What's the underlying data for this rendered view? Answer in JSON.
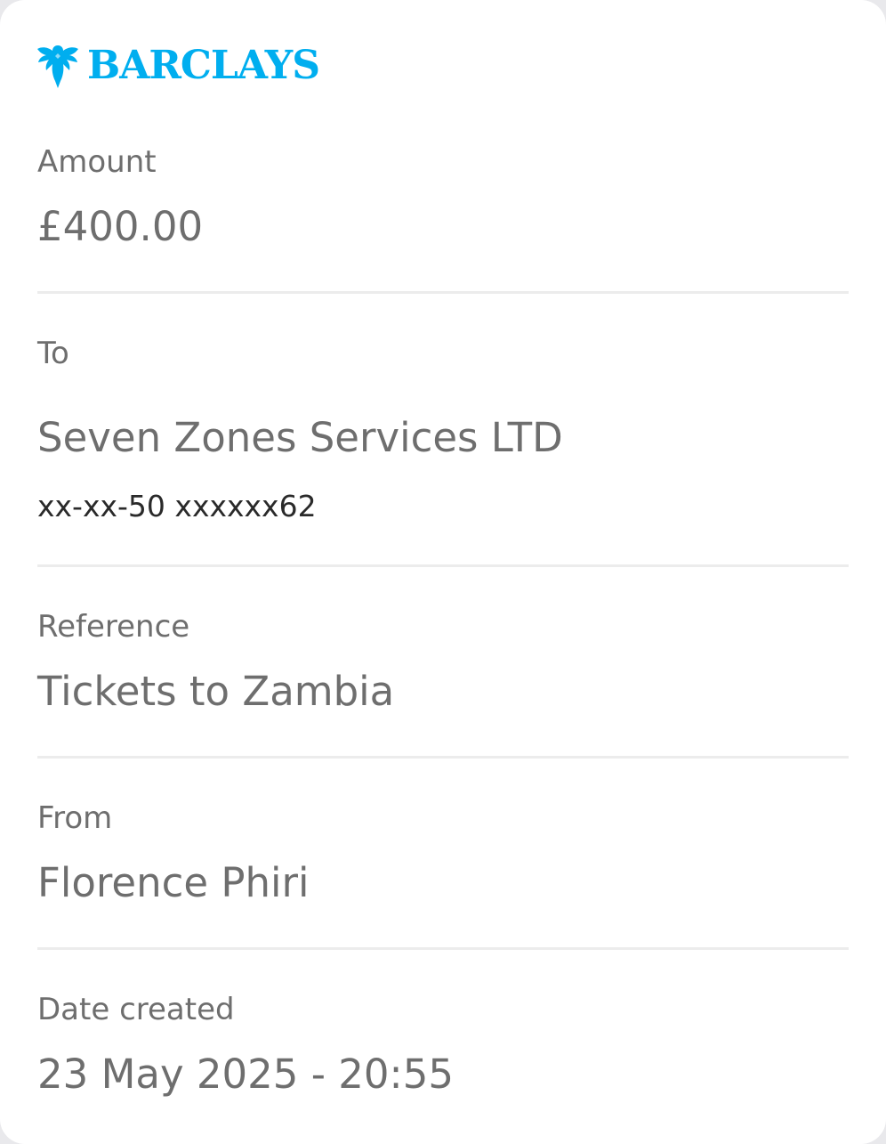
{
  "brand": {
    "name": "BARCLAYS",
    "logo_icon": "eagle-icon",
    "color": "#00aeef"
  },
  "fields": {
    "amount": {
      "label": "Amount",
      "value": "£400.00"
    },
    "to": {
      "label": "To",
      "value": "Seven Zones Services LTD",
      "account": "xx-xx-50 xxxxxx62"
    },
    "reference": {
      "label": "Reference",
      "value": "Tickets to Zambia"
    },
    "from": {
      "label": "From",
      "value": "Florence Phiri"
    },
    "date_created": {
      "label": "Date created",
      "value": "23 May 2025 - 20:55"
    }
  },
  "colors": {
    "text_muted": "#6e6e6e",
    "text_dark": "#2a2a2a",
    "divider": "#ececec",
    "background": "#ffffff"
  }
}
